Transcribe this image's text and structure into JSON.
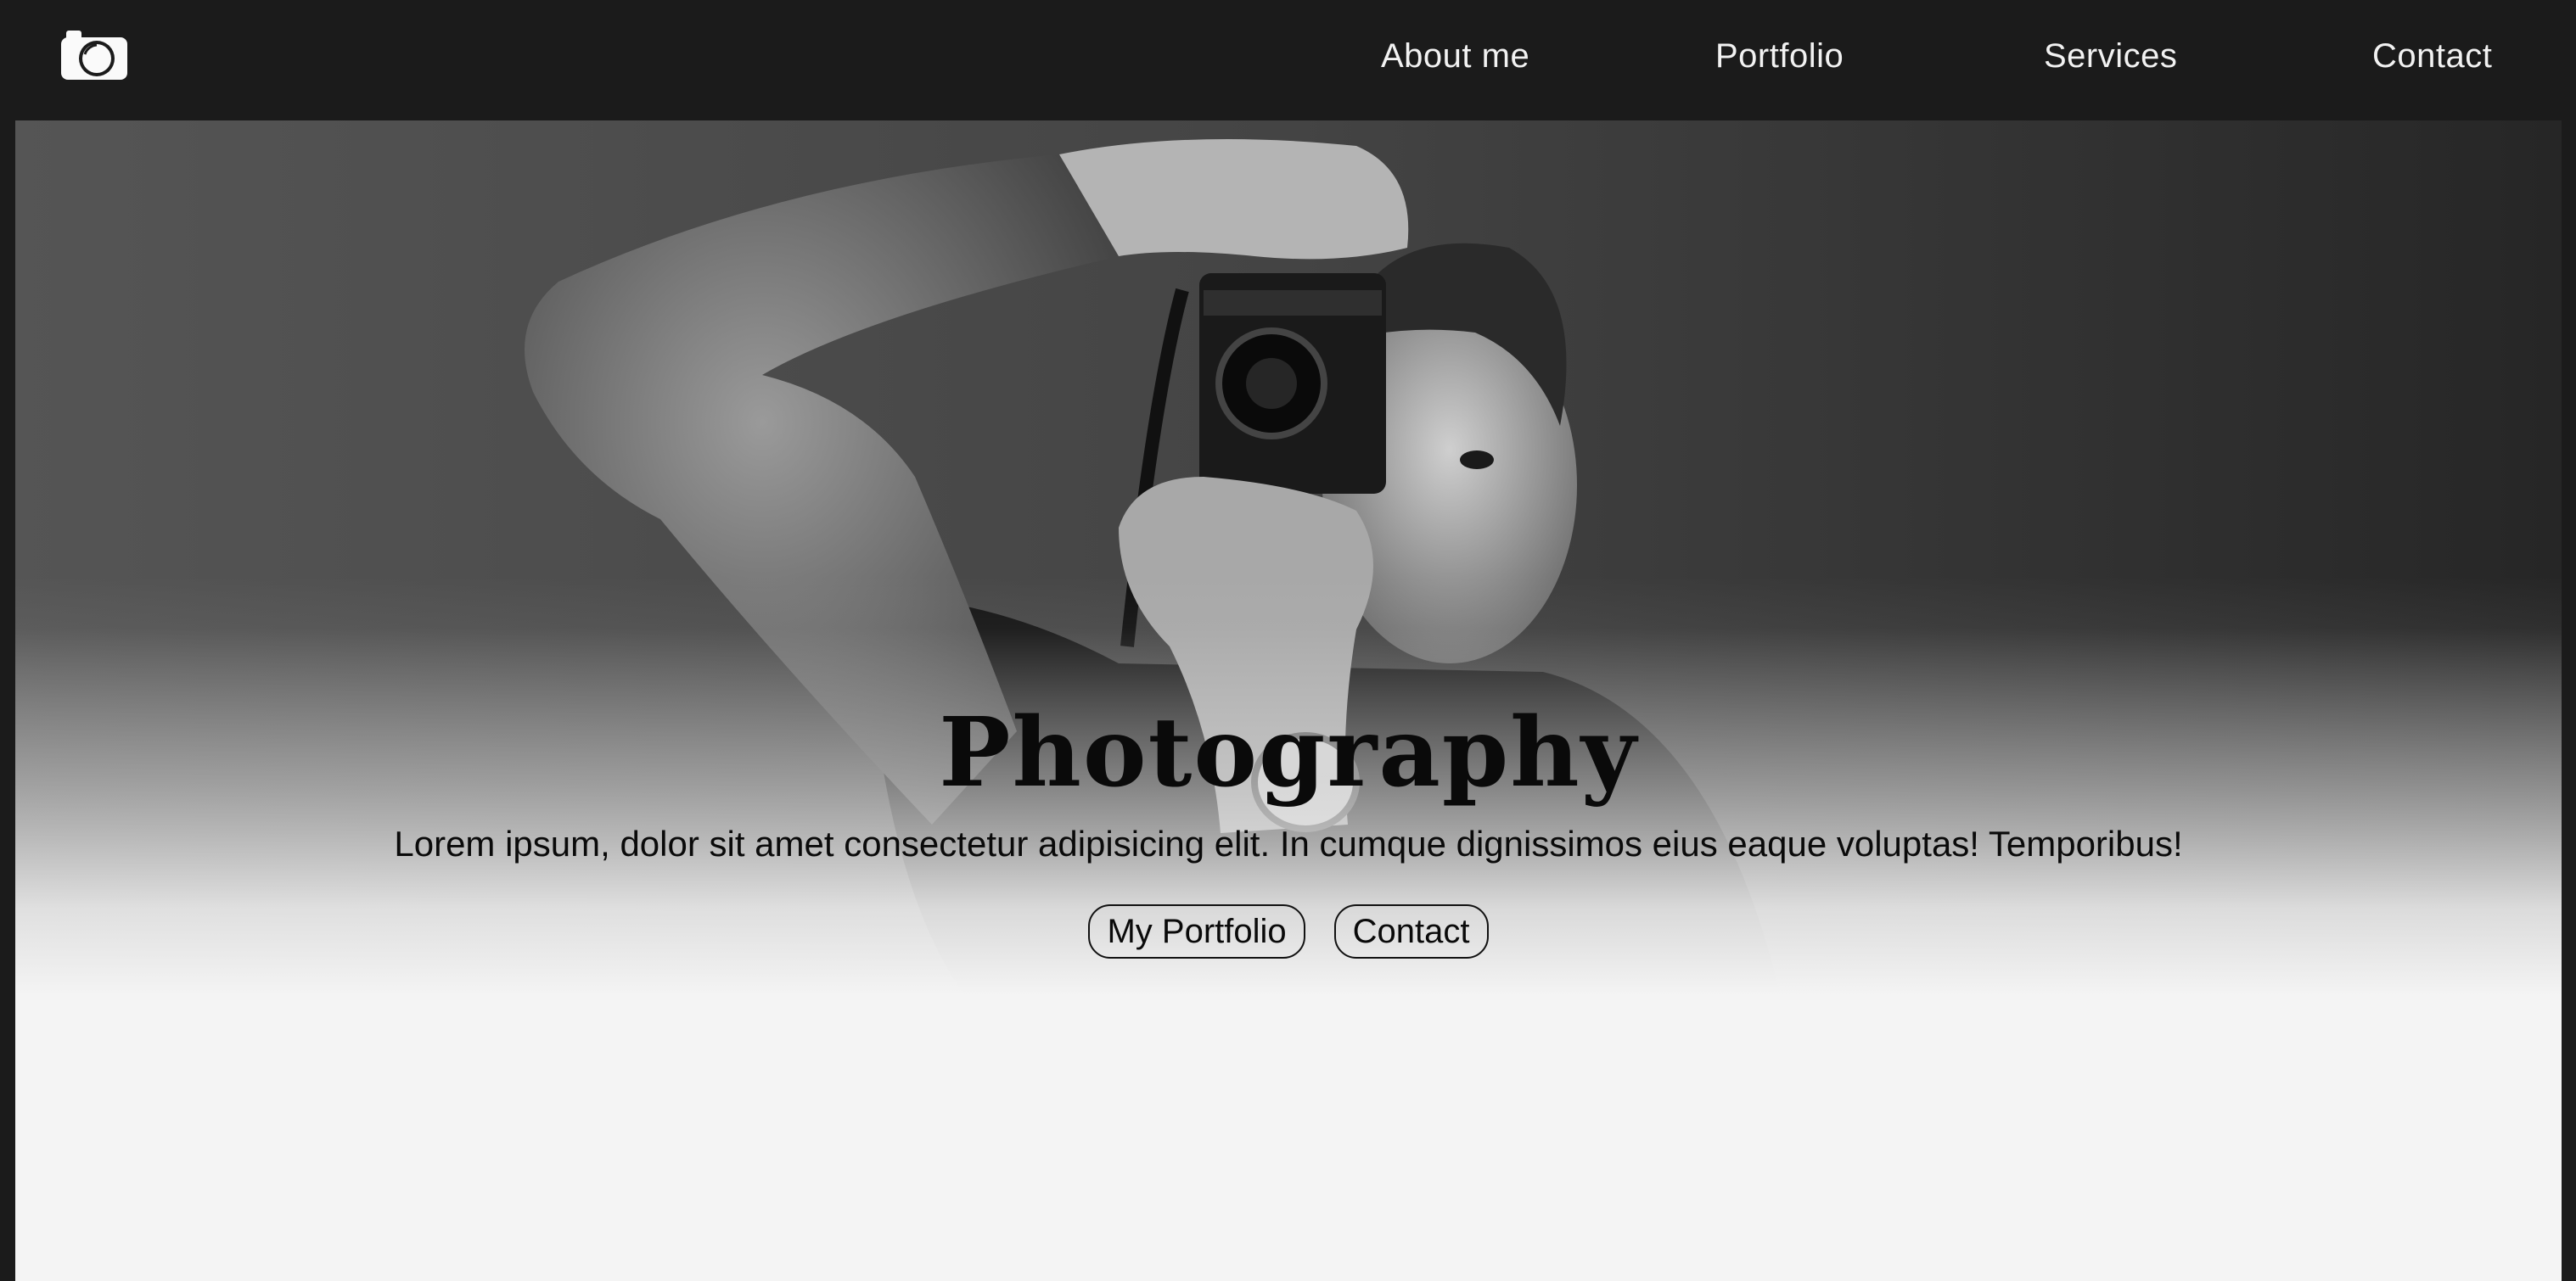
{
  "nav": {
    "logo_icon": "camera-icon",
    "links": [
      {
        "label": "About me"
      },
      {
        "label": "Portfolio"
      },
      {
        "label": "Services"
      },
      {
        "label": "Contact"
      }
    ]
  },
  "hero": {
    "title": "Photography",
    "subtitle": "Lorem ipsum, dolor sit amet consectetur adipisicing elit. In cumque dignissimos eius eaque voluptas! Temporibus!",
    "buttons": [
      {
        "label": "My Portfolio"
      },
      {
        "label": "Contact"
      }
    ],
    "image_description_icon": "photographer-hero-image"
  },
  "colors": {
    "navbar_bg": "#1b1b1b",
    "nav_text": "#f2f2f2",
    "page_bg": "#f4f4f4",
    "text_dark": "#0a0a0a"
  }
}
